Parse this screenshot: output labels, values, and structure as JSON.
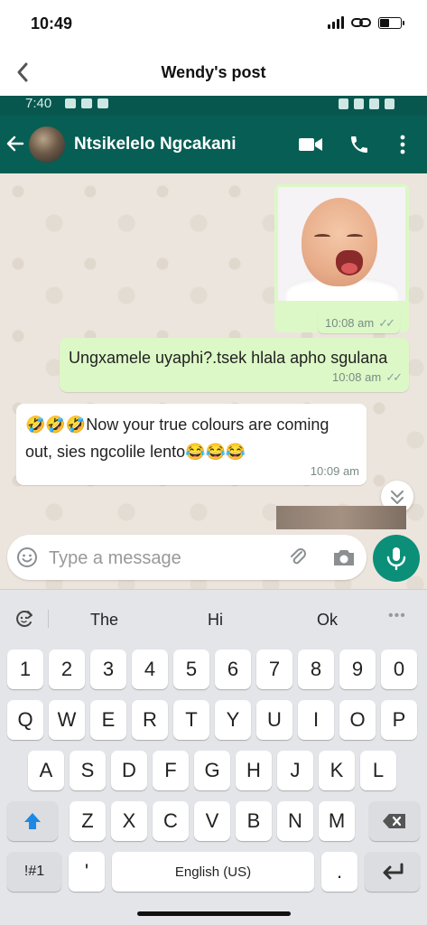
{
  "status_bar": {
    "time": "10:49"
  },
  "nav": {
    "title": "Wendy's post"
  },
  "whatsapp": {
    "status_time": "7:40",
    "contact_name": "Ntsikelelo Ngcakani",
    "messages": [
      {
        "type": "image",
        "time": "10:08 am",
        "ticks": "✓✓"
      },
      {
        "type": "outgoing",
        "text": "Ungxamele uyaphi?.tsek hlala apho sgulana",
        "time": "10:08 am",
        "ticks": "✓✓"
      },
      {
        "type": "incoming",
        "text": "🤣🤣🤣Now your true colours are coming out, sies ngcolile lento😂😂😂",
        "time": "10:09 am"
      }
    ],
    "input_placeholder": "Type a message"
  },
  "keyboard": {
    "suggestions": [
      "The",
      "Hi",
      "Ok"
    ],
    "more": "•••",
    "row_numbers": [
      "1",
      "2",
      "3",
      "4",
      "5",
      "6",
      "7",
      "8",
      "9",
      "0"
    ],
    "row_1": [
      "Q",
      "W",
      "E",
      "R",
      "T",
      "Y",
      "U",
      "I",
      "O",
      "P"
    ],
    "row_2": [
      "A",
      "S",
      "D",
      "F",
      "G",
      "H",
      "J",
      "K",
      "L"
    ],
    "row_3": [
      "Z",
      "X",
      "C",
      "V",
      "B",
      "N",
      "M"
    ],
    "symbols_label": "!#1",
    "apostrophe": "'",
    "space_label": "English (US)",
    "period": "."
  },
  "colors": {
    "whatsapp_header": "#075e54",
    "outgoing_bubble": "#dcf8c6",
    "mic_button": "#0b8f79",
    "shift_key": "#1e88e5"
  },
  "icons": [
    "back-chevron-icon",
    "back-arrow-icon",
    "video-call-icon",
    "phone-icon",
    "more-vert-icon",
    "emoji-icon",
    "attach-icon",
    "camera-icon",
    "mic-icon",
    "double-chevron-down-icon",
    "refresh-icon",
    "shift-icon",
    "backspace-icon",
    "enter-icon"
  ]
}
